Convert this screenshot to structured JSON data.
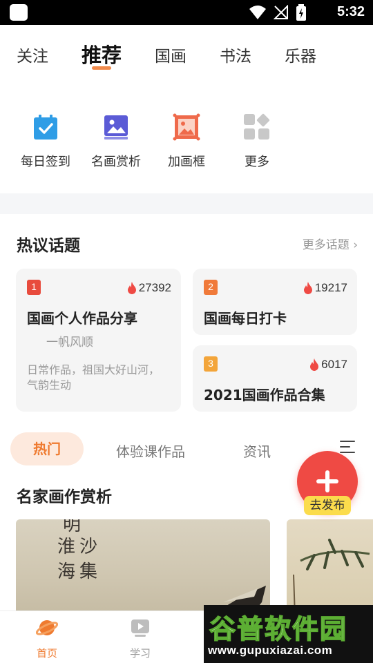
{
  "status_bar": {
    "time": "5:32",
    "icons": [
      "app-icon",
      "wifi-icon",
      "no-signal-icon",
      "battery-icon"
    ]
  },
  "top_tabs": [
    {
      "label": "关注",
      "active": false
    },
    {
      "label": "推荐",
      "active": true
    },
    {
      "label": "国画",
      "active": false
    },
    {
      "label": "书法",
      "active": false
    },
    {
      "label": "乐器",
      "active": false
    }
  ],
  "shortcuts": [
    {
      "label": "每日签到",
      "icon": "calendar-check-icon",
      "color": "#2f9de6"
    },
    {
      "label": "名画赏析",
      "icon": "picture-icon",
      "color": "#5b5bd6"
    },
    {
      "label": "加画框",
      "icon": "frame-icon",
      "color": "#ef6a4b"
    },
    {
      "label": "更多",
      "icon": "grid-more-icon",
      "color": "#c8c8c8"
    }
  ],
  "hot_topics": {
    "title": "热议话题",
    "more_label": "更多话题",
    "cards": [
      {
        "rank": "1",
        "rank_color": "#e84b3d",
        "heat": "27392",
        "title": "国画个人作品分享",
        "author": "一帆风顺",
        "desc": "日常作品，祖国大好山河，气韵生动"
      },
      {
        "rank": "2",
        "rank_color": "#f07a3a",
        "heat": "19217",
        "title": "国画每日打卡"
      },
      {
        "rank": "3",
        "rank_color": "#f3a53a",
        "heat": "6017",
        "title": "2021国画作品合集"
      }
    ]
  },
  "feed_tabs": [
    {
      "label": "热门",
      "active": true
    },
    {
      "label": "体验课作品",
      "active": false
    },
    {
      "label": "资讯",
      "active": false
    }
  ],
  "fab": {
    "label": "去发布"
  },
  "featured": {
    "title": "名家画作赏析",
    "calligraphy_col1": "明",
    "calligraphy_col2": "沙集",
    "calligraphy_col3": "淮海"
  },
  "bottom_nav": [
    {
      "label": "首页",
      "icon": "planet-icon",
      "active": true
    },
    {
      "label": "学习",
      "icon": "play-icon",
      "active": false
    }
  ],
  "watermark": {
    "big": "谷普软件园",
    "small": "www.gupuxiazai.com"
  },
  "colors": {
    "accent": "#ef7a2f",
    "fab": "#ef4a44",
    "fab_label": "#fbdc4c"
  }
}
